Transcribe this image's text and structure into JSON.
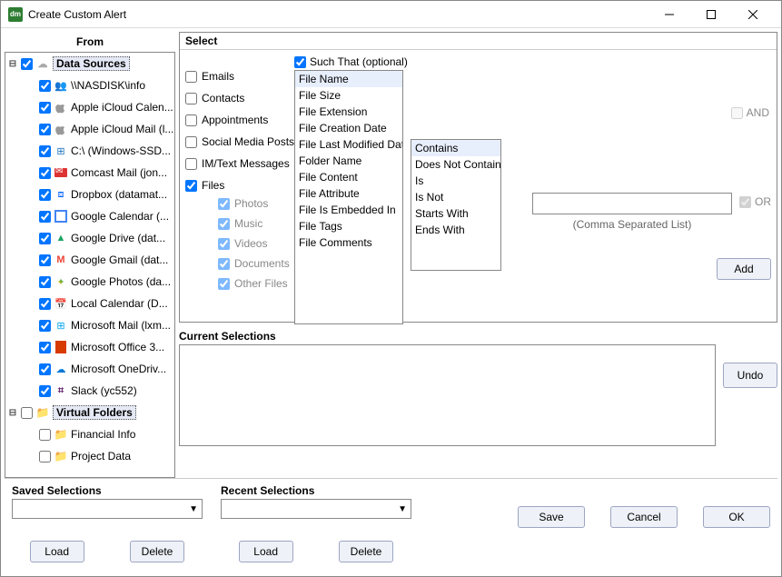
{
  "window": {
    "title": "Create Custom Alert",
    "app_icon_text": "dm"
  },
  "from": {
    "header": "From",
    "roots": [
      {
        "label": "Data Sources",
        "checked": true,
        "expanded": true,
        "icon": "cloud",
        "children": [
          {
            "label": "\\\\NASDISK\\info",
            "checked": true,
            "icon": "net"
          },
          {
            "label": "Apple iCloud Calen...",
            "checked": true,
            "icon": "apple"
          },
          {
            "label": "Apple iCloud Mail (l...",
            "checked": true,
            "icon": "apple"
          },
          {
            "label": "C:\\ (Windows-SSD...",
            "checked": true,
            "icon": "win"
          },
          {
            "label": "Comcast Mail (jon...",
            "checked": true,
            "icon": "mail"
          },
          {
            "label": "Dropbox (datamat...",
            "checked": true,
            "icon": "dropbox"
          },
          {
            "label": "Google Calendar (...",
            "checked": true,
            "icon": "gcal"
          },
          {
            "label": "Google Drive (dat...",
            "checked": true,
            "icon": "gdrive"
          },
          {
            "label": "Google Gmail (dat...",
            "checked": true,
            "icon": "gmail"
          },
          {
            "label": "Google Photos (da...",
            "checked": true,
            "icon": "gphotos"
          },
          {
            "label": "Local Calendar (D...",
            "checked": true,
            "icon": "cal"
          },
          {
            "label": "Microsoft Mail (lxm...",
            "checked": true,
            "icon": "ms"
          },
          {
            "label": "Microsoft Office 3...",
            "checked": true,
            "icon": "office"
          },
          {
            "label": "Microsoft OneDriv...",
            "checked": true,
            "icon": "onedrive"
          },
          {
            "label": "Slack (yc552)",
            "checked": true,
            "icon": "slack"
          }
        ]
      },
      {
        "label": "Virtual Folders",
        "checked": false,
        "expanded": true,
        "icon": "folder",
        "children": [
          {
            "label": "Financial Info",
            "checked": false,
            "icon": "folder"
          },
          {
            "label": "Project Data",
            "checked": false,
            "icon": "folder"
          }
        ]
      }
    ]
  },
  "select": {
    "header": "Select",
    "types": [
      {
        "label": "Emails",
        "checked": false
      },
      {
        "label": "Contacts",
        "checked": false
      },
      {
        "label": "Appointments",
        "checked": false
      },
      {
        "label": "Social Media Posts",
        "checked": false
      },
      {
        "label": "IM/Text Messages",
        "checked": false
      },
      {
        "label": "Files",
        "checked": true
      }
    ],
    "file_subtypes": [
      {
        "label": "Photos",
        "checked": true
      },
      {
        "label": "Music",
        "checked": true
      },
      {
        "label": "Videos",
        "checked": true
      },
      {
        "label": "Documents",
        "checked": true
      },
      {
        "label": "Other Files",
        "checked": true
      }
    ],
    "suchthat_label": "Such That  (optional)",
    "suchthat_checked": true,
    "fields": [
      "File Name",
      "File Size",
      "File Extension",
      "File Creation Date",
      "File Last Modified Date",
      "Folder Name",
      "File Content",
      "File Attribute",
      "File Is Embedded In",
      "File Tags",
      "File Comments"
    ],
    "selected_field": "File Name",
    "operators": [
      "Contains",
      "Does Not Contain",
      "Is",
      "Is Not",
      "Starts With",
      "Ends With"
    ],
    "selected_operator": "Contains",
    "value_input": "",
    "value_hint": "(Comma Separated List)",
    "and_label": "AND",
    "or_label": "OR",
    "add_label": "Add"
  },
  "current": {
    "header": "Current Selections",
    "undo_label": "Undo"
  },
  "bottom": {
    "saved_header": "Saved Selections",
    "recent_header": "Recent Selections",
    "load_label": "Load",
    "delete_label": "Delete",
    "save_label": "Save",
    "cancel_label": "Cancel",
    "ok_label": "OK"
  }
}
